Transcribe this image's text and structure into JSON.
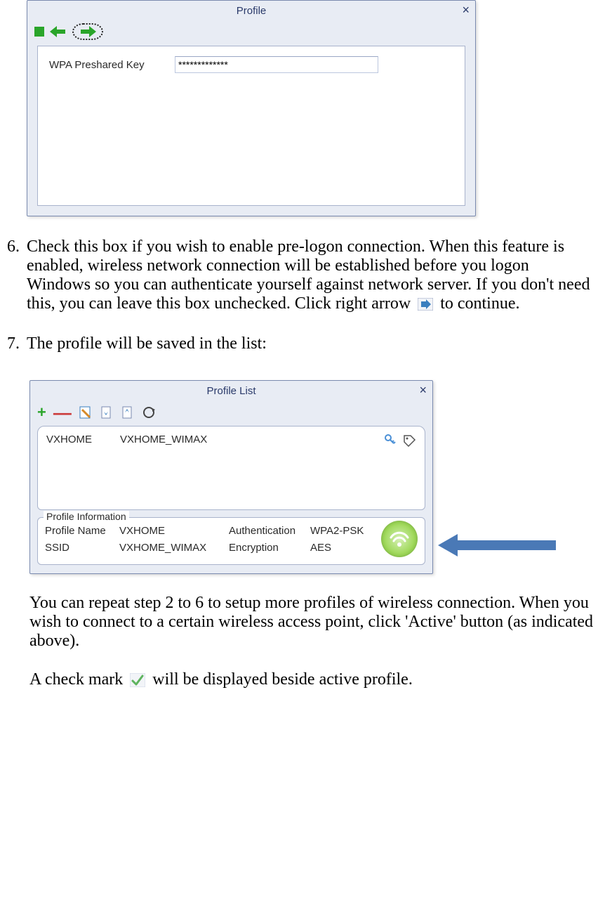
{
  "window1": {
    "title": "Profile",
    "field_label": "WPA Preshared Key",
    "field_value": "*************"
  },
  "step6": {
    "num": "6.",
    "text_a": "Check this box if you wish to enable pre-logon connection. When this feature is enabled, wireless network connection will be established before you logon Windows so you can authenticate yourself against network server. If you don't need this, you can leave this box unchecked. Click right arrow ",
    "text_b": " to continue."
  },
  "step7": {
    "num": "7.",
    "text": "The profile will be saved in the list:"
  },
  "window2": {
    "title": "Profile List",
    "row": {
      "name": "VXHOME",
      "ssid": "VXHOME_WIMAX"
    },
    "info": {
      "legend": "Profile Information",
      "labels": {
        "pn": "Profile Name",
        "ssid": "SSID",
        "auth": "Authentication",
        "enc": "Encryption"
      },
      "values": {
        "pn": "VXHOME",
        "ssid": "VXHOME_WIMAX",
        "auth": "WPA2-PSK",
        "enc": "AES"
      }
    }
  },
  "para1": "You can repeat step 2 to 6 to setup more profiles of wireless connection. When you wish to connect to a certain wireless access point, click 'Active' button (as indicated above).",
  "para2_a": "A check mark ",
  "para2_b": " will be displayed beside active profile."
}
